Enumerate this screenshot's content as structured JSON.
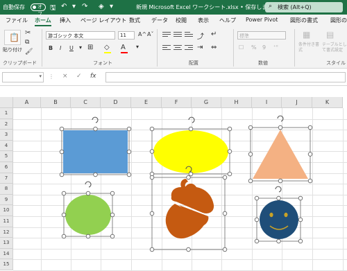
{
  "titlebar": {
    "autosave_label": "自動保存",
    "autosave_state": "オフ",
    "document_title": "新規 Microsoft Excel ワークシート.xlsx • 保存しました ∨",
    "search_placeholder": "検索 (Alt+Q)",
    "bg_color": "#1e7145"
  },
  "tabs": [
    "ファイル",
    "ホーム",
    "挿入",
    "ページ レイアウト",
    "数式",
    "データ",
    "校閲",
    "表示",
    "ヘルプ",
    "Power Pivot",
    "図形の書式",
    "図形の書式"
  ],
  "active_tab": "ホーム",
  "ribbon": {
    "clipboard": {
      "paste_label": "貼り付け",
      "group_label": "クリップボード"
    },
    "font": {
      "font_name": "游ゴシック 本文",
      "font_size": "11",
      "grow": "A^",
      "shrink": "Aˇ",
      "bold": "B",
      "italic": "I",
      "underline": "U",
      "group_label": "フォント"
    },
    "alignment": {
      "group_label": "配置"
    },
    "number": {
      "format": "標準",
      "percent": "%",
      "comma": "9",
      "group_label": "数値"
    },
    "styles": {
      "conditional_label": "条件付き書式",
      "table_label": "テーブルとして書式設定",
      "group_label": "スタイル"
    }
  },
  "formula_bar": {
    "cancel": "×",
    "enter": "✓",
    "fx": "fx",
    "namebox_value": "",
    "formula_value": ""
  },
  "sheet": {
    "columns": [
      "A",
      "B",
      "C",
      "D",
      "E",
      "F",
      "G",
      "H",
      "I",
      "J",
      "K"
    ],
    "rows": [
      "1",
      "2",
      "3",
      "4",
      "5",
      "6",
      "7",
      "8",
      "9",
      "10",
      "11",
      "12",
      "13",
      "14",
      "15"
    ]
  },
  "shapes": [
    {
      "name": "rectangle",
      "fill": "#5b9bd5"
    },
    {
      "name": "ellipse",
      "fill": "#ffff00"
    },
    {
      "name": "triangle",
      "fill": "#f4b183"
    },
    {
      "name": "circle",
      "fill": "#92d050"
    },
    {
      "name": "acorn",
      "fill": "#c55a11"
    },
    {
      "name": "smiley",
      "fill": "#1f4e79"
    }
  ],
  "colors": {
    "accent": "#1e7145",
    "selection_handle": "#ffffff"
  }
}
